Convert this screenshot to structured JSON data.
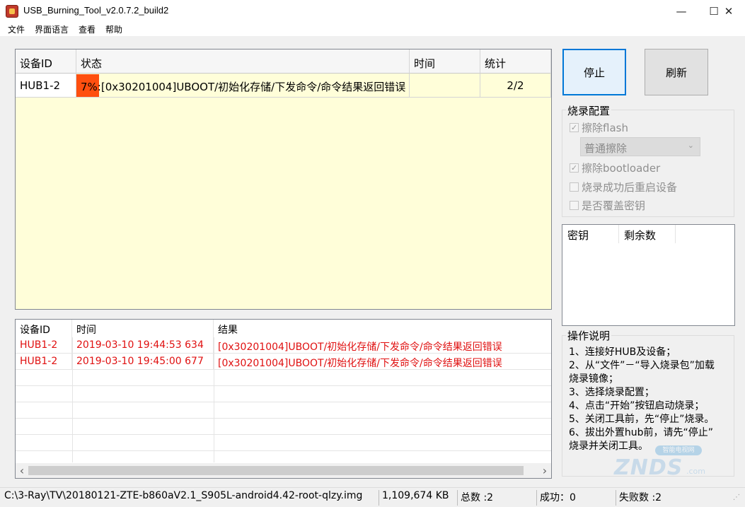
{
  "window": {
    "title": "USB_Burning_Tool_v2.0.7.2_build2",
    "controls": {
      "minimize": "—",
      "maximize": "☐",
      "close": "✕"
    }
  },
  "menu": [
    "文件",
    "界面语言",
    "查看",
    "帮助"
  ],
  "device_grid": {
    "columns": [
      "设备ID",
      "状态",
      "时间",
      "统计"
    ],
    "rows": [
      {
        "device_id": "HUB1-2",
        "progress_text": "7%",
        "progress_percent": 7,
        "status": ":[0x30201004]UBOOT/初始化存储/下发命令/命令结果返回错误",
        "time": "",
        "stats": "2/2"
      }
    ]
  },
  "log_grid": {
    "columns": [
      "设备ID",
      "时间",
      "结果"
    ],
    "rows": [
      {
        "device_id": "HUB1-2",
        "time": "2019-03-10 19:44:53 634",
        "result": "[0x30201004]UBOOT/初始化存储/下发命令/命令结果返回错误"
      },
      {
        "device_id": "HUB1-2",
        "time": "2019-03-10 19:45:00 677",
        "result": "[0x30201004]UBOOT/初始化存储/下发命令/命令结果返回错误"
      }
    ],
    "scroll_left_arrow": "‹",
    "scroll_right_arrow": "›"
  },
  "buttons": {
    "stop": "停止",
    "refresh": "刷新"
  },
  "burn_config": {
    "title": "烧录配置",
    "erase_flash": {
      "label": "擦除flash",
      "checked": true
    },
    "erase_mode": "普通擦除",
    "erase_bootloader": {
      "label": "擦除bootloader",
      "checked": true
    },
    "reboot_after_success": {
      "label": "烧录成功后重启设备",
      "checked": false
    },
    "overwrite_key": {
      "label": "是否覆盖密钥",
      "checked": false
    }
  },
  "key_list": {
    "columns": [
      "密钥",
      "剩余数"
    ]
  },
  "instructions": {
    "title": "操作说明",
    "lines": [
      "1、连接好HUB及设备；",
      "2、从“文件”－“导入烧录包”加载",
      "烧录镜像；",
      "3、选择烧录配置；",
      "4、点击“开始”按钮启动烧录；",
      "5、关闭工具前，先“停止”烧录。",
      "6、拔出外置hub前，请先“停止”",
      "烧录并关闭工具。"
    ]
  },
  "watermark": {
    "top": "智能电视网",
    "main": "ZNDS",
    "suffix": ".com"
  },
  "status_bar": {
    "image_path": "C:\\3-Ray\\TV\\20180121-ZTE-b860aV2.1_S905L-android4.42-root-qlzy.img",
    "file_size": "1,109,674 KB",
    "total": "总数 :2",
    "success": "成功：0",
    "failed": "失败数 :2"
  },
  "colors": {
    "progress": "#ff4f0f",
    "error_text": "#e01010",
    "grid_bg": "#fffed9",
    "focus": "#0078d7"
  }
}
